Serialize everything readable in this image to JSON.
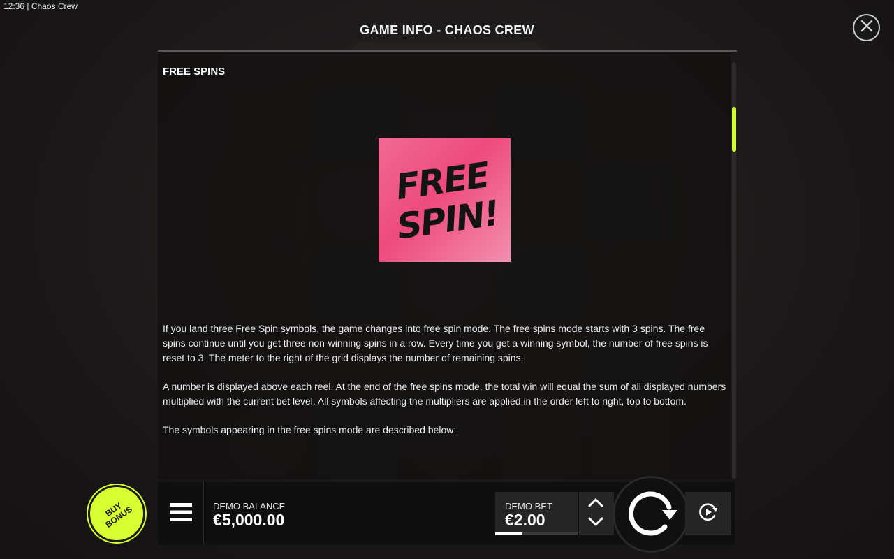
{
  "window": {
    "time_title": "12:36  |  Chaos Crew"
  },
  "panel": {
    "title": "GAME INFO - CHAOS CREW",
    "section_heading": "FREE SPINS",
    "symbol_caption_line1": "FREE",
    "symbol_caption_line2": "SPIN!",
    "paragraphs": [
      "If you land three Free Spin symbols, the game changes into free spin mode. The free spins mode starts with 3 spins. The free spins continue until you get three non-winning spins in a row. Every time you get a winning symbol, the number of free spins is reset to 3. The meter to the right of the grid displays the number of remaining spins.",
      "A number is displayed above each reel. At the end of the free spins mode, the total win will equal the sum of all displayed numbers multiplied with the current bet level. All symbols affecting the multipliers are applied in the order left to right, top to bottom.",
      "The symbols appearing in the free spins mode are described below:"
    ],
    "scroll_position_fraction": 0.11
  },
  "controls": {
    "buy_bonus_line1": "BUY",
    "buy_bonus_line2": "BONUS",
    "balance_label": "DEMO BALANCE",
    "balance_value": "€5,000.00",
    "bet_label": "DEMO BET",
    "bet_value": "€2.00",
    "bet_level_fraction": 0.33
  },
  "icons": {
    "close": "close-icon",
    "menu": "hamburger-menu-icon",
    "bet_up": "chevron-up-icon",
    "bet_down": "chevron-down-icon",
    "spin": "spin-arrow-icon",
    "autoplay": "autoplay-icon"
  },
  "colors": {
    "accent": "#d8ff2f",
    "symbol_pink": "#ee4b7d",
    "background": "#1c1a1a"
  }
}
